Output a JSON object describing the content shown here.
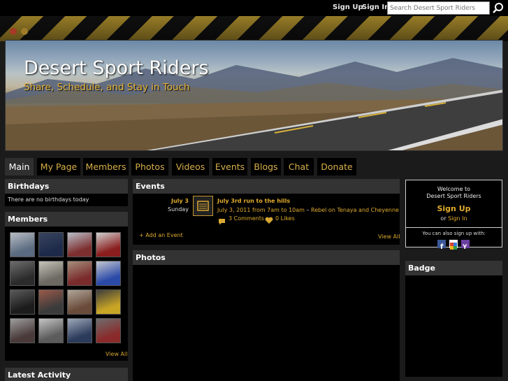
{
  "topbar": {
    "signup": "Sign Up",
    "signin": "Sign In",
    "search_placeholder": "Search Desert Sport Riders"
  },
  "header": {
    "title": "Desert Sport Riders",
    "tagline": "Share, Schedule, and Stay in Touch"
  },
  "nav": {
    "tabs": [
      "Main",
      "My Page",
      "Members",
      "Photos",
      "Videos",
      "Events",
      "Blogs",
      "Chat",
      "Donate"
    ]
  },
  "birthdays": {
    "heading": "Birthdays",
    "text": "There are no birthdays today"
  },
  "members": {
    "heading": "Members",
    "view_all": "View All",
    "count": 16
  },
  "latest_activity": {
    "heading": "Latest Activity"
  },
  "events": {
    "heading": "Events",
    "date": "July 3",
    "day": "Sunday",
    "title": "July 3rd run to the hills",
    "when": "July 3, 2011 from 7am to 10am",
    "separator": " – ",
    "location": "Rebel on Tenaya and Cheyenne",
    "comments": "3 Comments",
    "likes": "0 Likes",
    "add_event": "Add an Event",
    "view_all": "View All"
  },
  "photos": {
    "heading": "Photos"
  },
  "welcome": {
    "line1": "Welcome to",
    "line2": "Desert Sport Riders",
    "signup": "Sign Up",
    "or": "or",
    "signin": "Sign In",
    "also": "You can also sign up with:"
  },
  "badge": {
    "heading": "Badge"
  },
  "colors": {
    "accent": "#e0ac2c",
    "nav_bg": "#000000",
    "box_head": "#333333"
  }
}
